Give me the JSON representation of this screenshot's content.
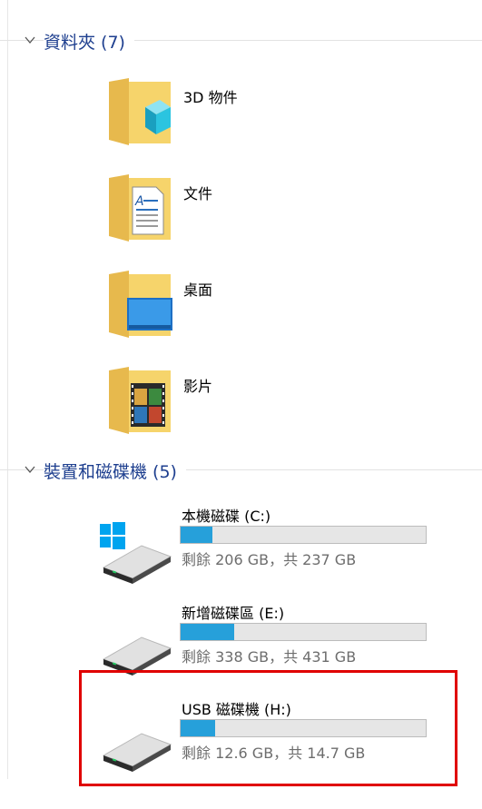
{
  "groups": {
    "folders": {
      "title": "資料夾 (7)"
    },
    "devices": {
      "title": "裝置和磁碟機 (5)"
    }
  },
  "folders": [
    {
      "name": "3D 物件",
      "icon": "3d-objects-icon"
    },
    {
      "name": "文件",
      "icon": "documents-icon"
    },
    {
      "name": "桌面",
      "icon": "desktop-icon"
    },
    {
      "name": "影片",
      "icon": "videos-icon"
    }
  ],
  "drives": [
    {
      "name": "本機磁碟 (C:)",
      "free_text": "剩餘 206 GB，共 237 GB",
      "used_fraction": 0.13,
      "icon": "windows-drive-icon"
    },
    {
      "name": "新增磁碟區 (E:)",
      "free_text": "剩餘 338 GB，共 431 GB",
      "used_fraction": 0.22,
      "icon": "hard-drive-icon"
    },
    {
      "name": "USB 磁碟機 (H:)",
      "free_text": "剩餘 12.6 GB，共 14.7 GB",
      "used_fraction": 0.14,
      "icon": "usb-drive-icon"
    }
  ],
  "colors": {
    "group_title": "#1e3f8f",
    "progress_fill": "#26a0da",
    "progress_track": "#e6e6e6",
    "highlight": "#e00000",
    "folder_yellow": "#f6d46b"
  }
}
